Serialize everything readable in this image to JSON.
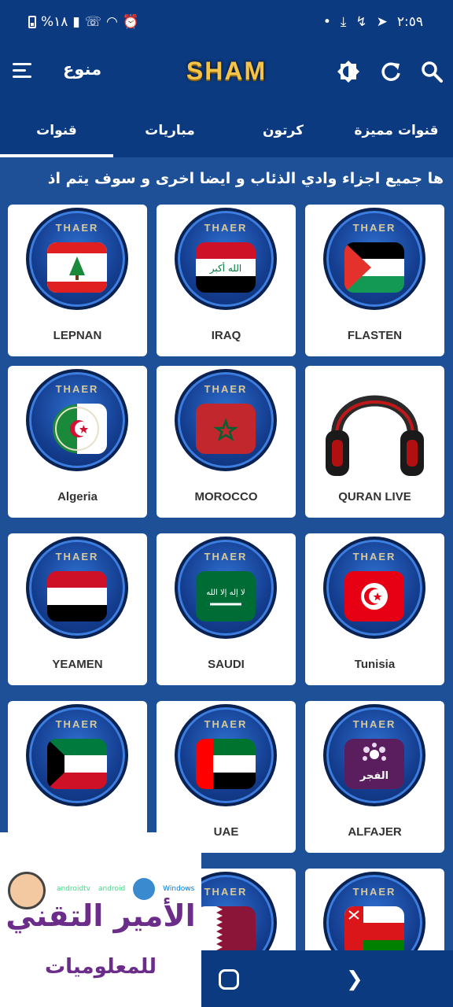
{
  "status_bar": {
    "time": "٢:٥٩",
    "battery": "%١٨",
    "left_icons": [
      "battery-icon",
      "signal-icon",
      "wifi-call-icon",
      "wifi-icon",
      "alarm-icon"
    ],
    "right_icons": [
      "dot-icon",
      "download-icon",
      "missed-call-icon",
      "telegram-icon"
    ]
  },
  "header": {
    "category": "منوع",
    "logo": "SHAM",
    "icons": [
      "menu-icon",
      "brightness-icon",
      "refresh-icon",
      "search-icon"
    ]
  },
  "tabs": [
    {
      "label": "قنوات"
    },
    {
      "label": "مباريات"
    },
    {
      "label": "كرتون"
    },
    {
      "label": "قنوات مميزة"
    }
  ],
  "marquee": "ها جميع اجزاء وادي الذئاب و ايضا اخرى و سوف يتم اذ",
  "channels": [
    {
      "name": "LEPNAN",
      "flag": "lebanon"
    },
    {
      "name": "IRAQ",
      "flag": "iraq"
    },
    {
      "name": "FLASTEN",
      "flag": "palestine"
    },
    {
      "name": "Algeria",
      "flag": "algeria"
    },
    {
      "name": "MOROCCO",
      "flag": "morocco"
    },
    {
      "name": "QURAN LIVE",
      "flag": "headphones"
    },
    {
      "name": "YEAMEN",
      "flag": "yemen"
    },
    {
      "name": "SAUDI",
      "flag": "saudi"
    },
    {
      "name": "Tunisia",
      "flag": "tunisia"
    },
    {
      "name": "",
      "flag": "kuwait"
    },
    {
      "name": "UAE",
      "flag": "uae"
    },
    {
      "name": "ALFAJER",
      "flag": "alfajer"
    },
    {
      "name": "",
      "flag": "qatar"
    },
    {
      "name": "",
      "flag": "oman"
    }
  ],
  "badge_text": "THAER",
  "alfajer_logo_text": "الفجر",
  "watermark": {
    "title": "الأمير التقني",
    "subtitle": "للمعلوميات",
    "platforms": [
      "androidtv",
      "android",
      "Windows"
    ]
  },
  "nav": [
    "home-icon",
    "back-icon"
  ],
  "colors": {
    "primary": "#0c3a80",
    "background": "#1d5096",
    "accent": "#f4c44a",
    "watermark": "#6b2c8a"
  }
}
